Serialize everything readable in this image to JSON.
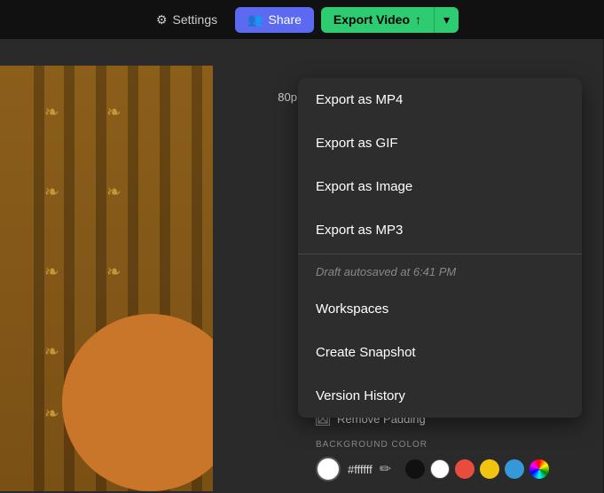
{
  "topbar": {
    "settings_label": "Settings",
    "share_label": "Share",
    "export_label": "Export Video"
  },
  "quality_badge": "80p",
  "dropdown": {
    "items": [
      {
        "id": "export-mp4",
        "label": "Export as MP4"
      },
      {
        "id": "export-gif",
        "label": "Export as GIF"
      },
      {
        "id": "export-image",
        "label": "Export as Image"
      },
      {
        "id": "export-mp3",
        "label": "Export as MP3"
      }
    ],
    "autosave_text": "Draft autosaved at 6:41 PM",
    "workspace_label": "Workspaces",
    "snapshot_label": "Create Snapshot",
    "history_label": "Version History"
  },
  "bottom": {
    "remove_padding_label": "Remove Padding",
    "bg_color_section_label": "BACKGROUND COLOR",
    "color_hex_value": "#ffffff",
    "color_swatches": [
      {
        "color": "#111111",
        "label": "black"
      },
      {
        "color": "#ffffff",
        "label": "white"
      },
      {
        "color": "#e74c3c",
        "label": "red"
      },
      {
        "color": "#f1c40f",
        "label": "yellow"
      },
      {
        "color": "#3498db",
        "label": "blue"
      }
    ]
  }
}
